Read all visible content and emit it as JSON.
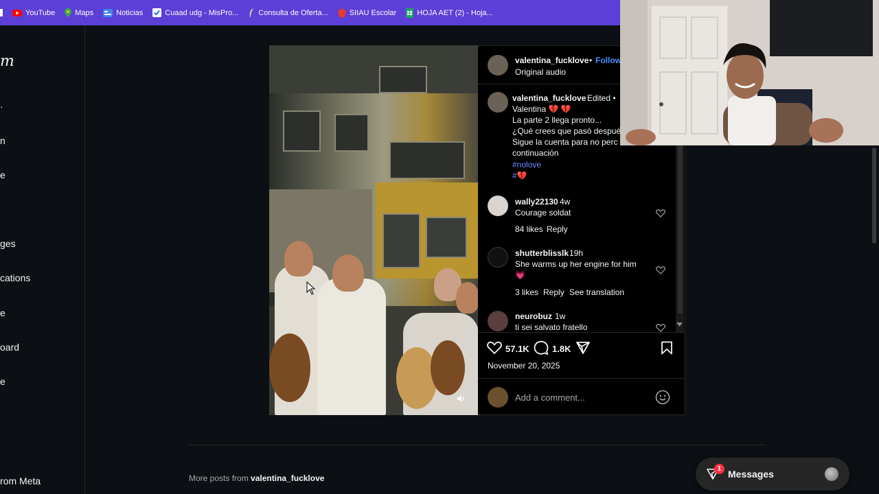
{
  "bookmarks": {
    "items": [
      {
        "label": "YouTube",
        "color": "#ff0000"
      },
      {
        "label": "Maps",
        "color": "#34a853"
      },
      {
        "label": "Noticias",
        "color": "#4285f4"
      },
      {
        "label": "Cuaad udg - MisPro...",
        "color": "#ffffff"
      },
      {
        "label": "Consulta de Oferta...",
        "color": "#c0b090"
      },
      {
        "label": "SIIAU Escolar",
        "color": "#e53935"
      },
      {
        "label": "HOJA AET (2) - Hoja...",
        "color": "#1fa463"
      }
    ]
  },
  "sidebar": {
    "logo_fragment": "m",
    "items": [
      {
        "label": "n"
      },
      {
        "label": "e"
      },
      {
        "label": "ges"
      },
      {
        "label": "cations"
      },
      {
        "label": "e"
      },
      {
        "label": "oard"
      },
      {
        "label": "e"
      },
      {
        "label": "rom Meta"
      }
    ]
  },
  "post": {
    "author": "valentina_fucklove",
    "follow_label": "Follow",
    "separator": "•",
    "audio": "Original audio",
    "caption": {
      "username": "valentina_fucklove",
      "edited": "Edited •",
      "lines": [
        "Valentina 💔 💔",
        "La parte 2 llega pronto...",
        "¿Qué crees que pasó despué",
        "Sigue la cuenta para no perc",
        "continuación"
      ],
      "hashtag": "#nolove",
      "hashtag2": "#💔"
    },
    "comments": [
      {
        "username": "wally22130",
        "time": "4w",
        "text": "Courage soldat",
        "likes": "84 likes",
        "reply": "Reply",
        "translate": ""
      },
      {
        "username": "shutterblisslk",
        "time": "19h",
        "text": "She warms up her engine for him",
        "text2": "💗",
        "likes": "3 likes",
        "reply": "Reply",
        "translate": "See translation"
      },
      {
        "username": "neurobuz",
        "time": "1w",
        "text": "ti sei salvato fratello"
      }
    ],
    "likes_count": "57.1K",
    "comments_count": "1.8K",
    "date": "November 20, 2025",
    "add_comment_placeholder": "Add a comment..."
  },
  "more_posts": {
    "prefix": "More posts from",
    "username": "valentina_fucklove"
  },
  "messages": {
    "label": "Messages",
    "badge": "1"
  },
  "colors": {
    "bookmark_bar": "#5b3fd6",
    "background": "#0c1014",
    "link": "#6a8cff",
    "heart": "#ff2d75"
  }
}
